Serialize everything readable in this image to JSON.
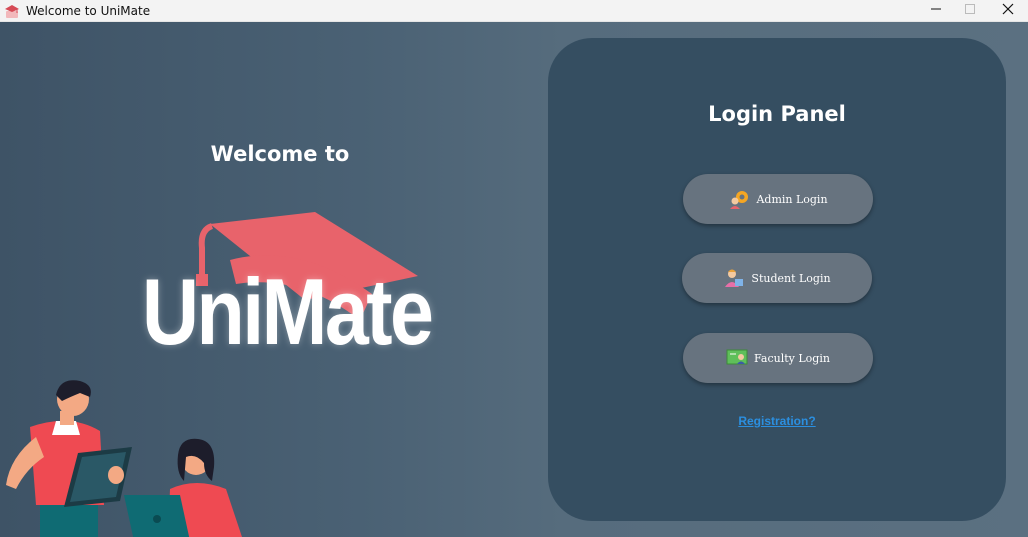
{
  "window": {
    "title": "Welcome to UniMate",
    "app_icon": "unimate-cap-icon",
    "controls": [
      "minimize-icon",
      "maximize-icon",
      "close-icon"
    ]
  },
  "left": {
    "welcome_text": "Welcome to",
    "logo_text": "UniMate",
    "logo_color": "#e8636b"
  },
  "panel": {
    "title": "Login Panel",
    "buttons": [
      {
        "label": "Admin Login",
        "icon": "admin-gear-icon"
      },
      {
        "label": "Student Login",
        "icon": "student-icon"
      },
      {
        "label": "Faculty Login",
        "icon": "faculty-board-icon"
      }
    ],
    "registration_link": "Registration?"
  },
  "colors": {
    "panel_bg": "#354e61",
    "button_bg": "#67737f",
    "link": "#2b8fe0",
    "accent": "#e8636b"
  }
}
